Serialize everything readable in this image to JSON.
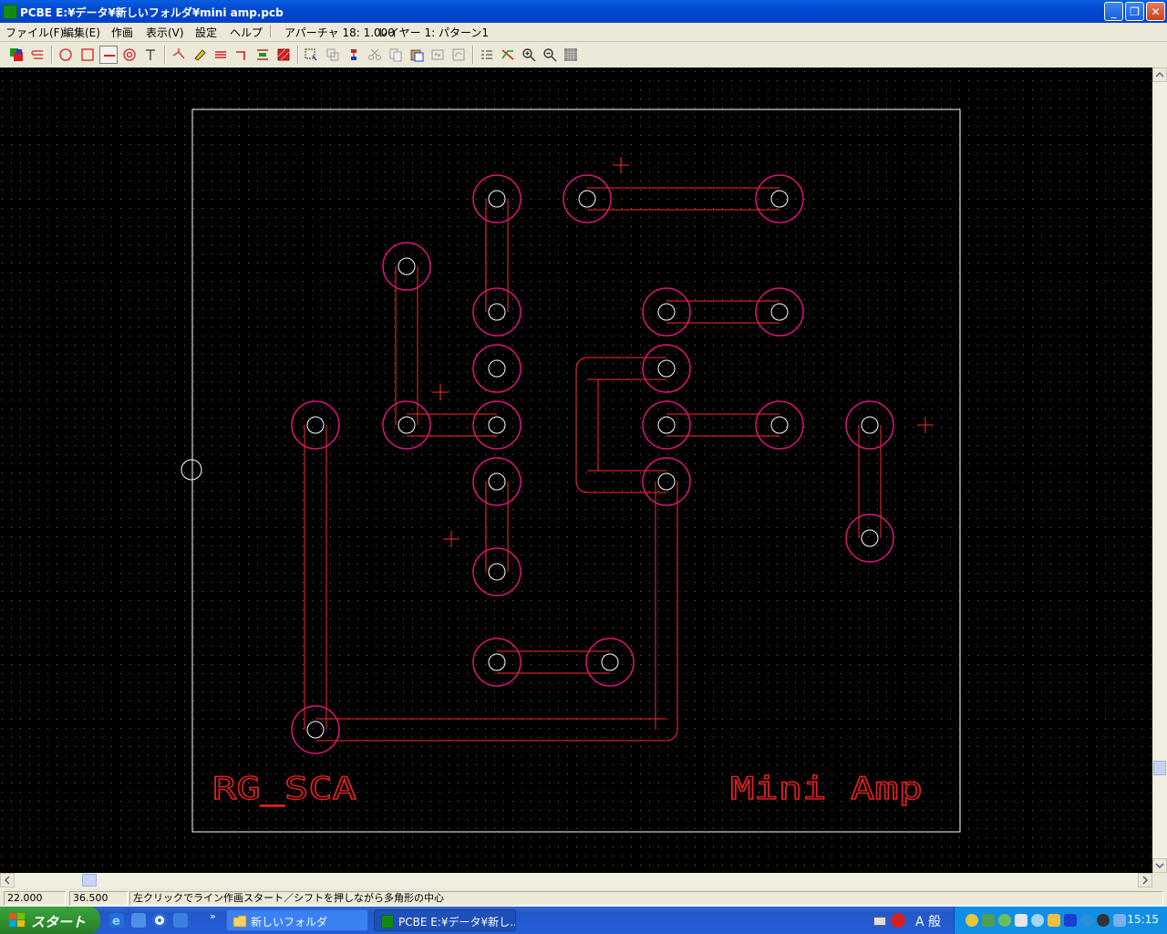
{
  "window": {
    "title": "PCBE  E:¥データ¥新しいフォルダ¥mini amp.pcb",
    "minimize_label": "_",
    "restore_label": "❐",
    "close_label": "✕"
  },
  "menu": {
    "items": [
      "ファイル(F)",
      "編集(E)",
      "作画",
      "表示(V)",
      "設定",
      "ヘルプ"
    ],
    "aperture": "アパーチャ 18: 1.000",
    "layer": "レイヤー 1: パターン1"
  },
  "toolbar": {
    "tools": [
      "layer-color-icon",
      "swap-layer-icon",
      "circle-pad-icon",
      "square-pad-icon",
      "line-icon",
      "donut-pad-icon",
      "text-tool-icon",
      "junction-icon",
      "edit-pen-icon",
      "parallel-lines-icon",
      "corner-line-icon",
      "align-icon",
      "fill-area-icon",
      "select-rect-icon",
      "copy-area-icon",
      "move-vertical-icon",
      "cut-icon",
      "copy-icon",
      "paste-icon",
      "mirror-icon",
      "rotate-icon",
      "list-icon",
      "reroute-icon",
      "zoom-in-icon",
      "zoom-out-icon",
      "grid-icon"
    ],
    "pressed": "line-icon"
  },
  "board": {
    "silk_left": "RG_SCA",
    "silk_right": "Mini Amp",
    "colors": {
      "background": "#000000",
      "trace": "#ff2a2a",
      "pad_ring": "#e0147c",
      "hole": "#ffffff",
      "grid": "#6a6a6a",
      "outline": "#ffffff"
    }
  },
  "status": {
    "x": "22.000",
    "y": "36.500",
    "message": "左クリックでライン作画スタート／シフトを押しながら多角形の中心"
  },
  "taskbar": {
    "start_label": "スタート",
    "tasks": [
      "新しいフォルダ",
      "PCBE  E:¥データ¥新し..."
    ],
    "ime": "A 般",
    "clock": "15:15"
  }
}
